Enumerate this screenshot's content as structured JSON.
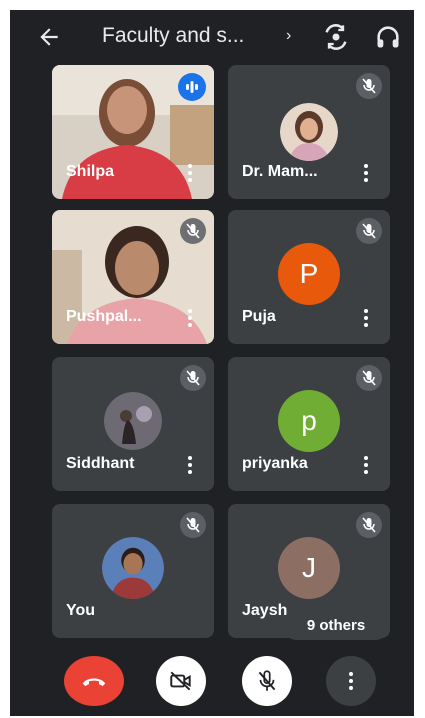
{
  "header": {
    "title": "Faculty and s...",
    "chevron": "›"
  },
  "participants": [
    {
      "name": "Shilpa",
      "state": "speaking"
    },
    {
      "name": "Dr. Mam...",
      "state": "muted"
    },
    {
      "name": "Pushpal...",
      "state": "muted"
    },
    {
      "name": "Puja",
      "state": "muted",
      "initial": "P",
      "color": "#e8590c"
    },
    {
      "name": "Siddhant",
      "state": "muted"
    },
    {
      "name": "priyanka",
      "state": "muted",
      "initial": "p",
      "color": "#70ad35"
    },
    {
      "name": "You",
      "state": "muted"
    },
    {
      "name": "Jaysh",
      "state": "muted",
      "initial": "J",
      "color": "#8d6e63"
    }
  ],
  "others_label": "9 others",
  "controls": {
    "end_call_color": "#ea4335",
    "camera": "camera-off-icon",
    "mic": "mic-off-icon",
    "more": "more-vert-icon"
  }
}
